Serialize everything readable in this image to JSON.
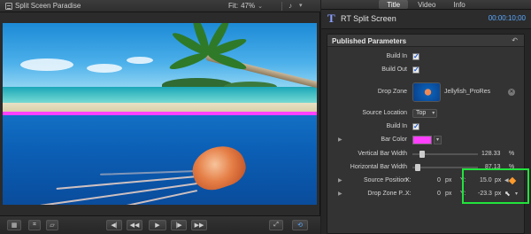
{
  "viewer": {
    "title": "Split Sceen Paradise",
    "fit_label": "Fit:",
    "fit_value": "47%",
    "fit_chevron": "⌄",
    "bar_color": "#ff40ff"
  },
  "inspector": {
    "tabs": [
      "Title",
      "Video",
      "Info"
    ],
    "active_tab": "Title",
    "icon": "T",
    "effect_name": "RT Split Screen",
    "timecode": "00:00:10;00",
    "panel_title": "Published Parameters",
    "rows": {
      "build_in": {
        "label": "Build In",
        "checked": true
      },
      "build_out": {
        "label": "Build Out",
        "checked": true
      },
      "drop_zone": {
        "label": "Drop Zone",
        "clip": "Jellyfish_ProRes"
      },
      "source_location": {
        "label": "Source Location",
        "value": "Top"
      },
      "build_in_2": {
        "label": "Build In",
        "checked": true
      },
      "bar_color": {
        "label": "Bar Color",
        "color": "#ff40ff"
      },
      "vertical_bar_width": {
        "label": "Vertical Bar Width",
        "value": "128.33",
        "unit": "%",
        "level": 0.12
      },
      "horizontal_bar_width": {
        "label": "Horizontal Bar Width",
        "value": "87.13",
        "unit": "%",
        "level": 0.05
      },
      "source_position": {
        "label": "Source Position",
        "x_label": "X:",
        "x_value": "0",
        "x_unit": "px",
        "y_label": "Y:",
        "y_value": "15.0",
        "y_unit": "px"
      },
      "drop_zone_p": {
        "label": "Drop Zone P...",
        "x_label": "X:",
        "x_value": "0",
        "x_unit": "px",
        "y_label": "Y:",
        "y_value": "-23.3",
        "y_unit": "px"
      }
    },
    "keyframe_color": "#ff9a2b",
    "highlight_color": "#22e33c"
  }
}
